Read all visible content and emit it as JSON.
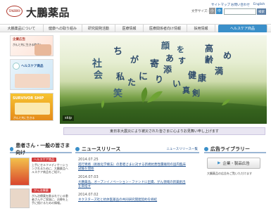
{
  "header": {
    "logo_mark": "TAIHO",
    "company_name": "大鵬薬品",
    "font_size_label": "文字サイズ：",
    "font_sizes": [
      "小",
      "中",
      "大"
    ],
    "top_links": [
      "サイトマップ",
      "お問い合わせ",
      "English"
    ],
    "search_button": "検索"
  },
  "nav": {
    "items": [
      "大鵬薬品について",
      "健康への取り組み",
      "研究開発活動",
      "医療情報",
      "医療関係者向け情報",
      "採用情報",
      "ヘルスケア商品"
    ]
  },
  "sidebar": {
    "ad1_title": "企業広告",
    "ad1_caption": "がんと共に生きる時代へ",
    "ad2_title": "ヘルスケア商品",
    "ad3_title": "SURVIVOR SHIP",
    "ad3_caption": "がんと共に生きる"
  },
  "hero": {
    "words": [
      "社",
      "会",
      "ち",
      "が",
      "私",
      "た",
      "に",
      "寄",
      "り",
      "添",
      "い",
      "笑",
      "顔",
      "を",
      "あ",
      "す",
      "高",
      "齢",
      "め",
      "満",
      "健",
      "康",
      "真",
      "剣"
    ],
    "skip_label": "skip"
  },
  "notice": {
    "text": "東日本大震災により被災された皆さまに心よりお見舞い申し上げます"
  },
  "columns": {
    "patients_heading": "患者さん・一般の皆さま向け",
    "healthcare_pill": "ヘルスケア商品",
    "healthcare_text": "上手にセルフメディケーションされるために、大鵬薬品ヘルスケア商品をご紹介。",
    "cancer_pill": "がん治療薬",
    "cancer_text": "がん治療薬を飲まれている患者さんやご家族に、治療を上手に続けるための情報。",
    "news_heading": "ニュースリリース",
    "news_more": "ニュースリリース一覧",
    "news": [
      {
        "date": "2014.07.25",
        "title": "進行胃癌（術後化学療法）の患者さまに対する新規抗悪性腫瘍剤の国内臨床試験を開始"
      },
      {
        "date": "2014.07.03",
        "title": "大鵬薬品、オープンイノベーション・ファンドに出資、がん領域の新薬創出を目指す"
      },
      {
        "date": "2014.07.02",
        "title": "ネクスターズ社と抗体医薬品の共同研究開発契約を締結"
      }
    ],
    "ad_library_heading": "広告ライブラリー",
    "ad_library_button": "企業・製品広告",
    "ad_library_caption": "大鵬薬品の広告をご覧いただけます"
  }
}
